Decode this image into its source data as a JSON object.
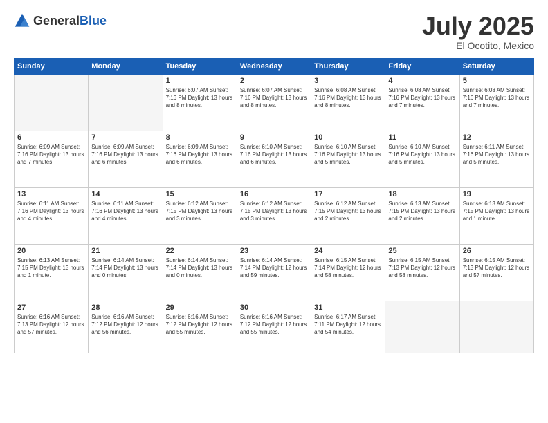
{
  "header": {
    "logo_general": "General",
    "logo_blue": "Blue",
    "main_title": "July 2025",
    "subtitle": "El Ocotito, Mexico"
  },
  "days_of_week": [
    "Sunday",
    "Monday",
    "Tuesday",
    "Wednesday",
    "Thursday",
    "Friday",
    "Saturday"
  ],
  "weeks": [
    [
      {
        "day": "",
        "info": ""
      },
      {
        "day": "",
        "info": ""
      },
      {
        "day": "1",
        "info": "Sunrise: 6:07 AM\nSunset: 7:16 PM\nDaylight: 13 hours and 8 minutes."
      },
      {
        "day": "2",
        "info": "Sunrise: 6:07 AM\nSunset: 7:16 PM\nDaylight: 13 hours and 8 minutes."
      },
      {
        "day": "3",
        "info": "Sunrise: 6:08 AM\nSunset: 7:16 PM\nDaylight: 13 hours and 8 minutes."
      },
      {
        "day": "4",
        "info": "Sunrise: 6:08 AM\nSunset: 7:16 PM\nDaylight: 13 hours and 7 minutes."
      },
      {
        "day": "5",
        "info": "Sunrise: 6:08 AM\nSunset: 7:16 PM\nDaylight: 13 hours and 7 minutes."
      }
    ],
    [
      {
        "day": "6",
        "info": "Sunrise: 6:09 AM\nSunset: 7:16 PM\nDaylight: 13 hours and 7 minutes."
      },
      {
        "day": "7",
        "info": "Sunrise: 6:09 AM\nSunset: 7:16 PM\nDaylight: 13 hours and 6 minutes."
      },
      {
        "day": "8",
        "info": "Sunrise: 6:09 AM\nSunset: 7:16 PM\nDaylight: 13 hours and 6 minutes."
      },
      {
        "day": "9",
        "info": "Sunrise: 6:10 AM\nSunset: 7:16 PM\nDaylight: 13 hours and 6 minutes."
      },
      {
        "day": "10",
        "info": "Sunrise: 6:10 AM\nSunset: 7:16 PM\nDaylight: 13 hours and 5 minutes."
      },
      {
        "day": "11",
        "info": "Sunrise: 6:10 AM\nSunset: 7:16 PM\nDaylight: 13 hours and 5 minutes."
      },
      {
        "day": "12",
        "info": "Sunrise: 6:11 AM\nSunset: 7:16 PM\nDaylight: 13 hours and 5 minutes."
      }
    ],
    [
      {
        "day": "13",
        "info": "Sunrise: 6:11 AM\nSunset: 7:16 PM\nDaylight: 13 hours and 4 minutes."
      },
      {
        "day": "14",
        "info": "Sunrise: 6:11 AM\nSunset: 7:16 PM\nDaylight: 13 hours and 4 minutes."
      },
      {
        "day": "15",
        "info": "Sunrise: 6:12 AM\nSunset: 7:15 PM\nDaylight: 13 hours and 3 minutes."
      },
      {
        "day": "16",
        "info": "Sunrise: 6:12 AM\nSunset: 7:15 PM\nDaylight: 13 hours and 3 minutes."
      },
      {
        "day": "17",
        "info": "Sunrise: 6:12 AM\nSunset: 7:15 PM\nDaylight: 13 hours and 2 minutes."
      },
      {
        "day": "18",
        "info": "Sunrise: 6:13 AM\nSunset: 7:15 PM\nDaylight: 13 hours and 2 minutes."
      },
      {
        "day": "19",
        "info": "Sunrise: 6:13 AM\nSunset: 7:15 PM\nDaylight: 13 hours and 1 minute."
      }
    ],
    [
      {
        "day": "20",
        "info": "Sunrise: 6:13 AM\nSunset: 7:15 PM\nDaylight: 13 hours and 1 minute."
      },
      {
        "day": "21",
        "info": "Sunrise: 6:14 AM\nSunset: 7:14 PM\nDaylight: 13 hours and 0 minutes."
      },
      {
        "day": "22",
        "info": "Sunrise: 6:14 AM\nSunset: 7:14 PM\nDaylight: 13 hours and 0 minutes."
      },
      {
        "day": "23",
        "info": "Sunrise: 6:14 AM\nSunset: 7:14 PM\nDaylight: 12 hours and 59 minutes."
      },
      {
        "day": "24",
        "info": "Sunrise: 6:15 AM\nSunset: 7:14 PM\nDaylight: 12 hours and 58 minutes."
      },
      {
        "day": "25",
        "info": "Sunrise: 6:15 AM\nSunset: 7:13 PM\nDaylight: 12 hours and 58 minutes."
      },
      {
        "day": "26",
        "info": "Sunrise: 6:15 AM\nSunset: 7:13 PM\nDaylight: 12 hours and 57 minutes."
      }
    ],
    [
      {
        "day": "27",
        "info": "Sunrise: 6:16 AM\nSunset: 7:13 PM\nDaylight: 12 hours and 57 minutes."
      },
      {
        "day": "28",
        "info": "Sunrise: 6:16 AM\nSunset: 7:12 PM\nDaylight: 12 hours and 56 minutes."
      },
      {
        "day": "29",
        "info": "Sunrise: 6:16 AM\nSunset: 7:12 PM\nDaylight: 12 hours and 55 minutes."
      },
      {
        "day": "30",
        "info": "Sunrise: 6:16 AM\nSunset: 7:12 PM\nDaylight: 12 hours and 55 minutes."
      },
      {
        "day": "31",
        "info": "Sunrise: 6:17 AM\nSunset: 7:11 PM\nDaylight: 12 hours and 54 minutes."
      },
      {
        "day": "",
        "info": ""
      },
      {
        "day": "",
        "info": ""
      }
    ]
  ]
}
